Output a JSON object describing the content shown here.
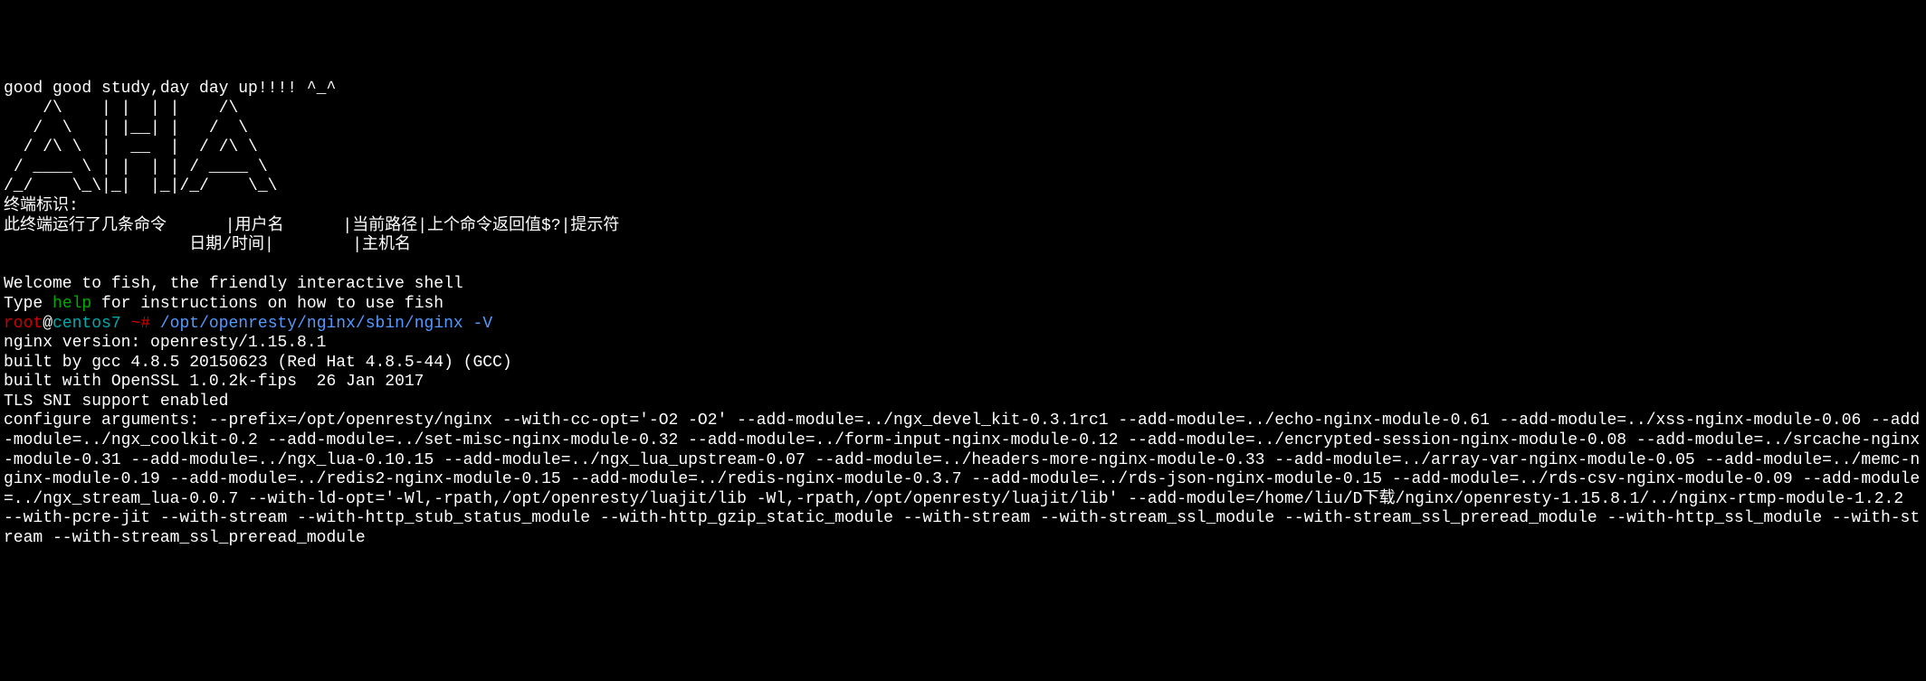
{
  "motd": {
    "line1": "good good study,day day up!!!! ^_^",
    "ascii_art": "    /\\    | |  | |    /\\\n   /  \\   | |__| |   /  \\\n  / /\\ \\  |  __  |  / /\\ \\\n / ____ \\ | |  | | / ____ \\\n/_/    \\_\\|_|  |_|/_/    \\_\\",
    "terminal_label": "终端标识:",
    "info_line1": "此终端运行了几条命令      |用户名      |当前路径|上个命令返回值$?|提示符",
    "info_line2": "                   日期/时间|        |主机名"
  },
  "fish_welcome": {
    "line1": "Welcome to fish, the friendly interactive shell",
    "line2_prefix": "Type ",
    "line2_help": "help",
    "line2_suffix": " for instructions on how to use fish"
  },
  "prompt": {
    "user": "root",
    "at": "@",
    "host": "centos7",
    "separator": " ~# ",
    "command": "/opt/openresty/nginx/sbin/nginx -V"
  },
  "output": {
    "version": "nginx version: openresty/1.15.8.1",
    "built_by": "built by gcc 4.8.5 20150623 (Red Hat 4.8.5-44) (GCC)",
    "openssl": "built with OpenSSL 1.0.2k-fips  26 Jan 2017",
    "tls": "TLS SNI support enabled",
    "configure": "configure arguments: --prefix=/opt/openresty/nginx --with-cc-opt='-O2 -O2' --add-module=../ngx_devel_kit-0.3.1rc1 --add-module=../echo-nginx-module-0.61 --add-module=../xss-nginx-module-0.06 --add-module=../ngx_coolkit-0.2 --add-module=../set-misc-nginx-module-0.32 --add-module=../form-input-nginx-module-0.12 --add-module=../encrypted-session-nginx-module-0.08 --add-module=../srcache-nginx-module-0.31 --add-module=../ngx_lua-0.10.15 --add-module=../ngx_lua_upstream-0.07 --add-module=../headers-more-nginx-module-0.33 --add-module=../array-var-nginx-module-0.05 --add-module=../memc-nginx-module-0.19 --add-module=../redis2-nginx-module-0.15 --add-module=../redis-nginx-module-0.3.7 --add-module=../rds-json-nginx-module-0.15 --add-module=../rds-csv-nginx-module-0.09 --add-module=../ngx_stream_lua-0.0.7 --with-ld-opt='-Wl,-rpath,/opt/openresty/luajit/lib -Wl,-rpath,/opt/openresty/luajit/lib' --add-module=/home/liu/D下载/nginx/openresty-1.15.8.1/../nginx-rtmp-module-1.2.2 --with-pcre-jit --with-stream --with-http_stub_status_module --with-http_gzip_static_module --with-stream --with-stream_ssl_module --with-stream_ssl_preread_module --with-http_ssl_module --with-stream --with-stream_ssl_preread_module"
  }
}
